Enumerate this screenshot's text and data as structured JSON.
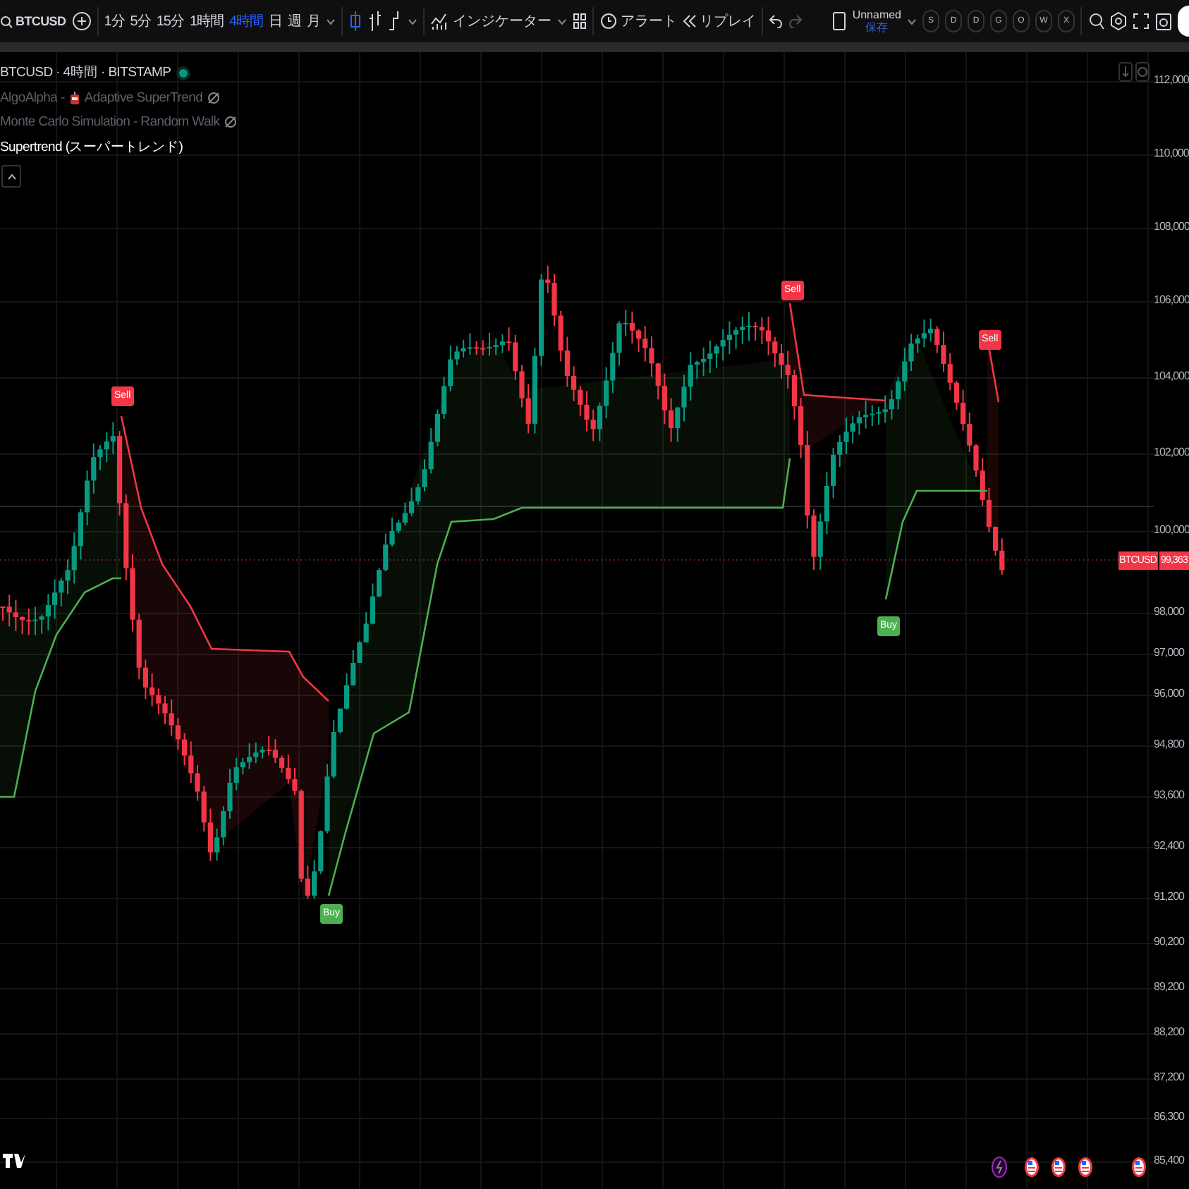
{
  "toolbar": {
    "symbol": "BTCUSD",
    "intervals": [
      {
        "label": "1分",
        "selected": false
      },
      {
        "label": "5分",
        "selected": false
      },
      {
        "label": "15分",
        "selected": false
      },
      {
        "label": "1時間",
        "selected": false
      },
      {
        "label": "4時間",
        "selected": true
      },
      {
        "label": "日",
        "selected": false
      },
      {
        "label": "週",
        "selected": false
      },
      {
        "label": "月",
        "selected": false
      }
    ],
    "indicators_label": "インジケーター",
    "alert_label": "アラート",
    "replay_label": "リプレイ",
    "layout": {
      "name": "Unnamed",
      "save": "保存"
    },
    "quick_buttons": [
      "S",
      "D",
      "D",
      "G",
      "O",
      "W",
      "X"
    ]
  },
  "legend": {
    "main": "BTCUSD · 4時間 · BITSTAMP",
    "indicators": [
      {
        "kind": "badge",
        "prefix": "AlgoAlpha -",
        "name": "Adaptive SuperTrend",
        "hidden": true
      },
      {
        "kind": "plain",
        "name": "Monte Carlo Simulation - Random Walk",
        "hidden": true
      },
      {
        "kind": "plain",
        "name": "Supertrend (スーパートレンド)",
        "hidden": false
      }
    ]
  },
  "signals": [
    {
      "kind": "sell",
      "label": "Sell"
    },
    {
      "kind": "buy",
      "label": "Buy"
    },
    {
      "kind": "sell",
      "label": "Sell"
    },
    {
      "kind": "buy",
      "label": "Buy"
    },
    {
      "kind": "sell",
      "label": "Sell"
    }
  ],
  "price_axis": {
    "ticks": [
      "112,000",
      "110,000",
      "108,000",
      "106,000",
      "104,000",
      "102,000",
      "100,000",
      "98,000",
      "97,000",
      "96,000",
      "94,800",
      "93,600",
      "92,400",
      "91,200",
      "90,200",
      "89,200",
      "88,200",
      "87,200",
      "86,300",
      "85,400"
    ],
    "last_price": {
      "symbol": "BTCUSD",
      "price": "99,363"
    }
  },
  "events": [
    {
      "kind": "lightning"
    },
    {
      "kind": "flag"
    },
    {
      "kind": "flag"
    },
    {
      "kind": "flag"
    },
    {
      "kind": "flag"
    }
  ]
}
